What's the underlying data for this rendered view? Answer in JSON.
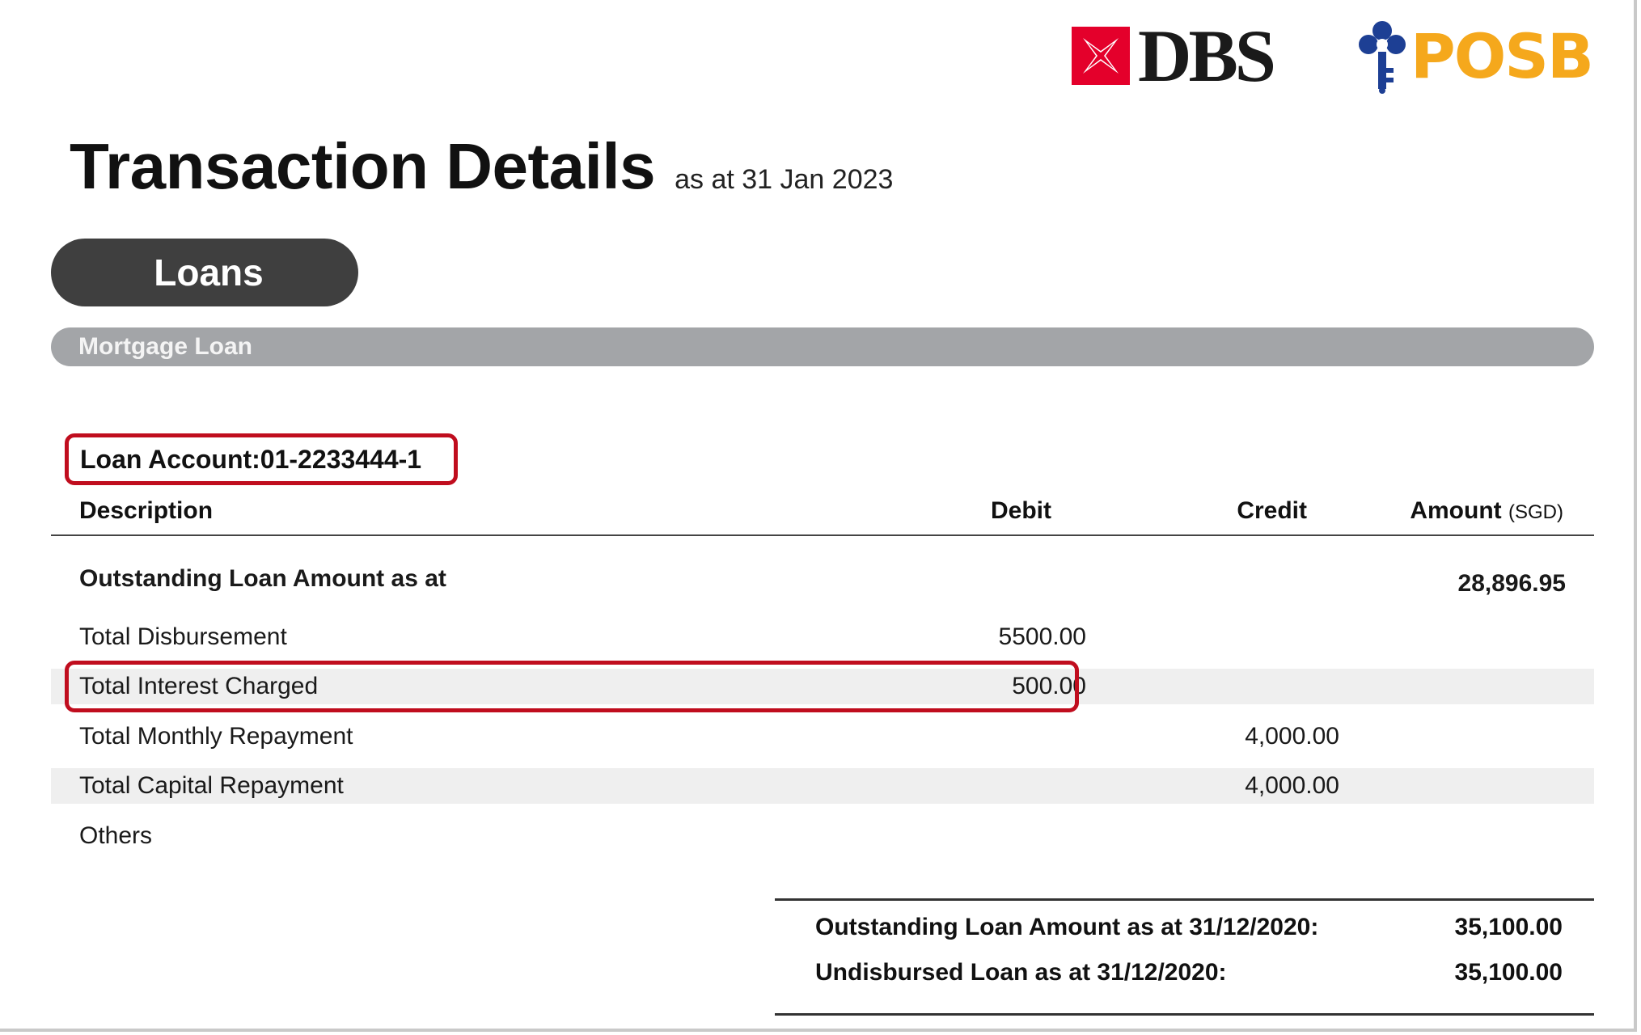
{
  "branding": {
    "dbs_text": "DBS",
    "posb_text": "POSB",
    "dbs_color": "#e4002b",
    "posb_key_color": "#1d3f94",
    "posb_text_color": "#f5a81c"
  },
  "header": {
    "title": "Transaction Details",
    "as_at": "as at 31 Jan 2023"
  },
  "tab": {
    "label": "Loans"
  },
  "section": {
    "label": "Mortgage Loan"
  },
  "account": {
    "label": "Loan Account:01-2233444-1"
  },
  "table": {
    "headers": {
      "description": "Description",
      "debit": "Debit",
      "credit": "Credit",
      "amount": "Amount",
      "amount_unit": "(SGD)"
    },
    "rows": [
      {
        "description": "Outstanding Loan Amount as at",
        "debit": "",
        "credit": "",
        "amount": "28,896.95"
      },
      {
        "description": "Total Disbursement",
        "debit": "5500.00",
        "credit": "",
        "amount": ""
      },
      {
        "description": "Total Interest Charged",
        "debit": "500.00",
        "credit": "",
        "amount": ""
      },
      {
        "description": "Total Monthly Repayment",
        "debit": "",
        "credit": "4,000.00",
        "amount": ""
      },
      {
        "description": "Total Capital Repayment",
        "debit": "",
        "credit": "4,000.00",
        "amount": ""
      },
      {
        "description": "Others",
        "debit": "",
        "credit": "",
        "amount": ""
      }
    ]
  },
  "summary": [
    {
      "label": "Outstanding Loan Amount as at 31/12/2020:",
      "value": "35,100.00"
    },
    {
      "label": "Undisbursed Loan as at 31/12/2020:",
      "value": "35,100.00"
    }
  ],
  "highlight_color": "#c00d1e"
}
